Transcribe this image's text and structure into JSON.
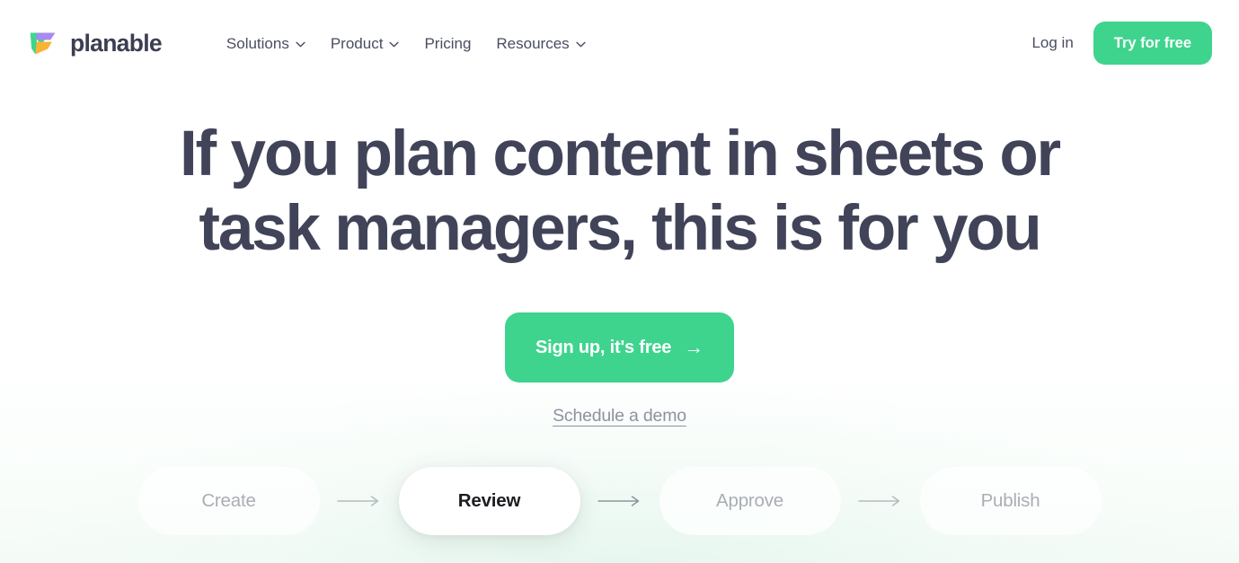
{
  "brand": {
    "name": "planable",
    "logo_icon": "planable-logo-icon",
    "logo_colors": {
      "green": "#3ed48e",
      "purple": "#a78bf0",
      "orange": "#f9b233"
    }
  },
  "nav": {
    "items": [
      {
        "label": "Solutions",
        "has_dropdown": true
      },
      {
        "label": "Product",
        "has_dropdown": true
      },
      {
        "label": "Pricing",
        "has_dropdown": false
      },
      {
        "label": "Resources",
        "has_dropdown": true
      }
    ]
  },
  "header_actions": {
    "login_label": "Log in",
    "try_label": "Try for free"
  },
  "hero": {
    "headline_line1": "If you plan content in sheets or",
    "headline_line2": "task managers, this is for you",
    "cta_label": "Sign up, it's free",
    "cta_arrow": "→",
    "demo_label": "Schedule a demo"
  },
  "workflow": {
    "steps": [
      {
        "label": "Create",
        "active": false
      },
      {
        "label": "Review",
        "active": true
      },
      {
        "label": "Approve",
        "active": false
      },
      {
        "label": "Publish",
        "active": false
      }
    ],
    "separator_icon": "arrow-right-icon"
  },
  "colors": {
    "accent_green": "#3ed48e",
    "headline": "#414458",
    "nav_text": "#4a4d61",
    "muted_text": "#a9aeb4",
    "link_text": "#8e929e"
  }
}
